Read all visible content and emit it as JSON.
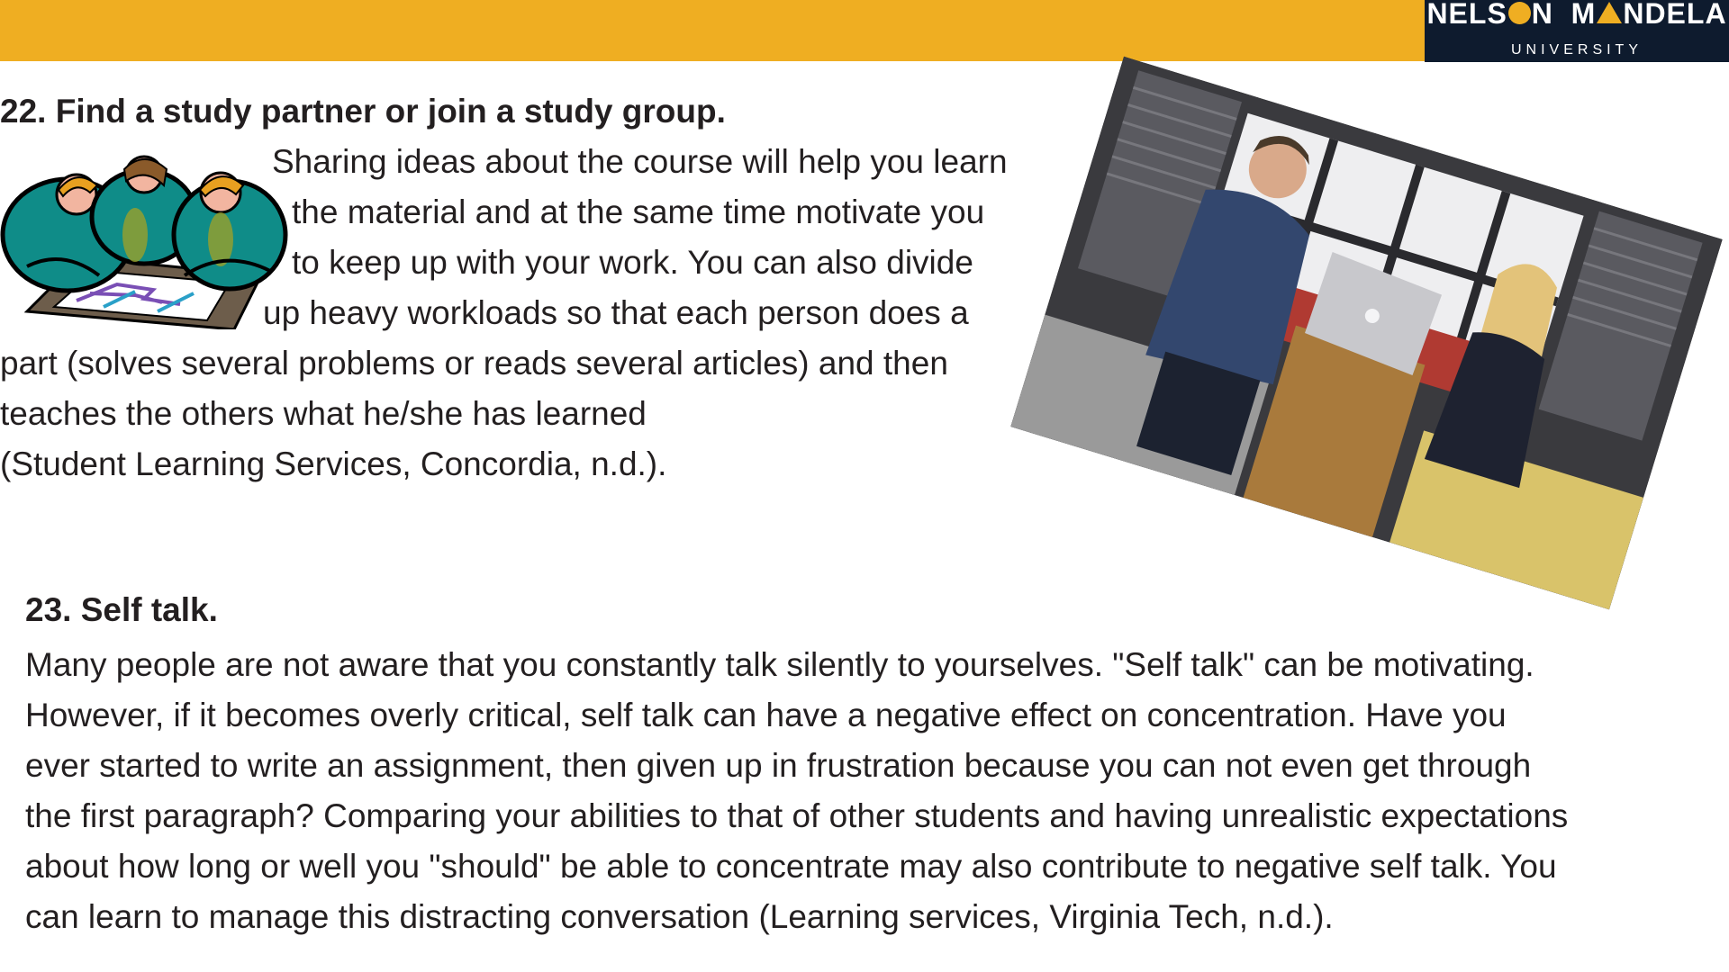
{
  "header": {
    "bar_color": "#efae22",
    "logo": {
      "name_part1": "NELS",
      "name_part2": "N",
      "name_part3": "M",
      "name_part4": "NDELA",
      "subtitle": "UNIVERSITY",
      "background": "#0e1b2e",
      "accent": "#efae22"
    }
  },
  "section22": {
    "heading": "22. Find a study partner or join a study group.",
    "lines": [
      "Sharing ideas about the course will help you learn",
      "the material and at the same time motivate you",
      "to keep up with your work. You can also divide",
      "up heavy workloads so that each person does a",
      "part (solves several problems or reads several articles) and then",
      "teaches the others what he/she has learned",
      "(Student Learning Services, Concordia, n.d.)."
    ],
    "clipart_icon": "study-group-clipart",
    "photo_icon": "students-with-laptop-photo"
  },
  "section23": {
    "heading": "23. Self talk.",
    "lines": [
      "Many people are not aware that you constantly talk silently to yourselves. \"Self talk\" can be motivating.",
      "However, if it becomes overly critical, self talk can have a negative effect on concentration. Have you",
      "ever started to write an assignment, then given up in frustration because you can not even get through",
      "the first paragraph? Comparing your abilities to that of other students and having unrealistic expectations",
      "about how long or well you \"should\" be able to concentrate may also contribute to negative self talk. You",
      "can learn to manage this distracting conversation (Learning services, Virginia Tech, n.d.)."
    ]
  }
}
